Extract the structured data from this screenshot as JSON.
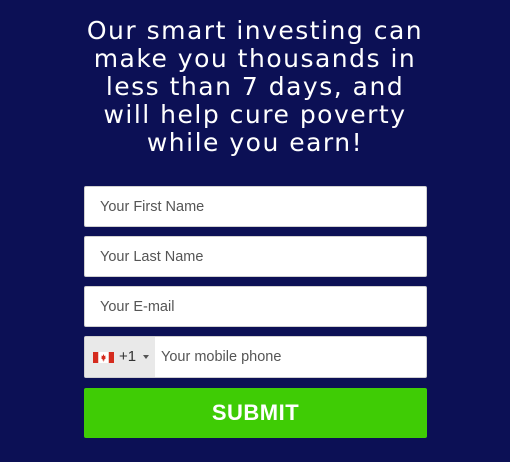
{
  "headline": {
    "lines": [
      "Our smart investing can",
      "make you thousands in",
      "less than 7 days, and",
      "will help cure poverty",
      "while you earn!"
    ]
  },
  "form": {
    "first_name": {
      "placeholder": "Your First Name",
      "value": ""
    },
    "last_name": {
      "placeholder": "Your Last Name",
      "value": ""
    },
    "email": {
      "placeholder": "Your E-mail",
      "value": ""
    },
    "phone": {
      "country_flag_icon": "canada-flag-icon",
      "dial_code": "+1",
      "placeholder": "Your mobile phone",
      "value": ""
    },
    "submit_label": "SUBMIT"
  },
  "colors": {
    "background": "#0c1055",
    "submit_button": "#3fcc05",
    "text": "#ffffff"
  }
}
